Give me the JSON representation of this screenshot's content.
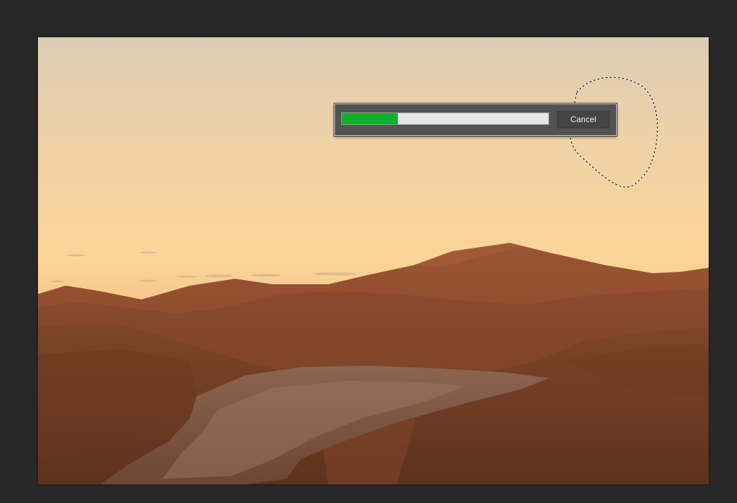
{
  "progress_dialog": {
    "progress_fraction": 0.27,
    "cancel_label": "Cancel",
    "fill_color": "#10b02c"
  },
  "canvas": {
    "sky_top_color": "#dccbb3",
    "sky_horizon_color": "#f8c98c",
    "dune_color": "#7c4329"
  }
}
